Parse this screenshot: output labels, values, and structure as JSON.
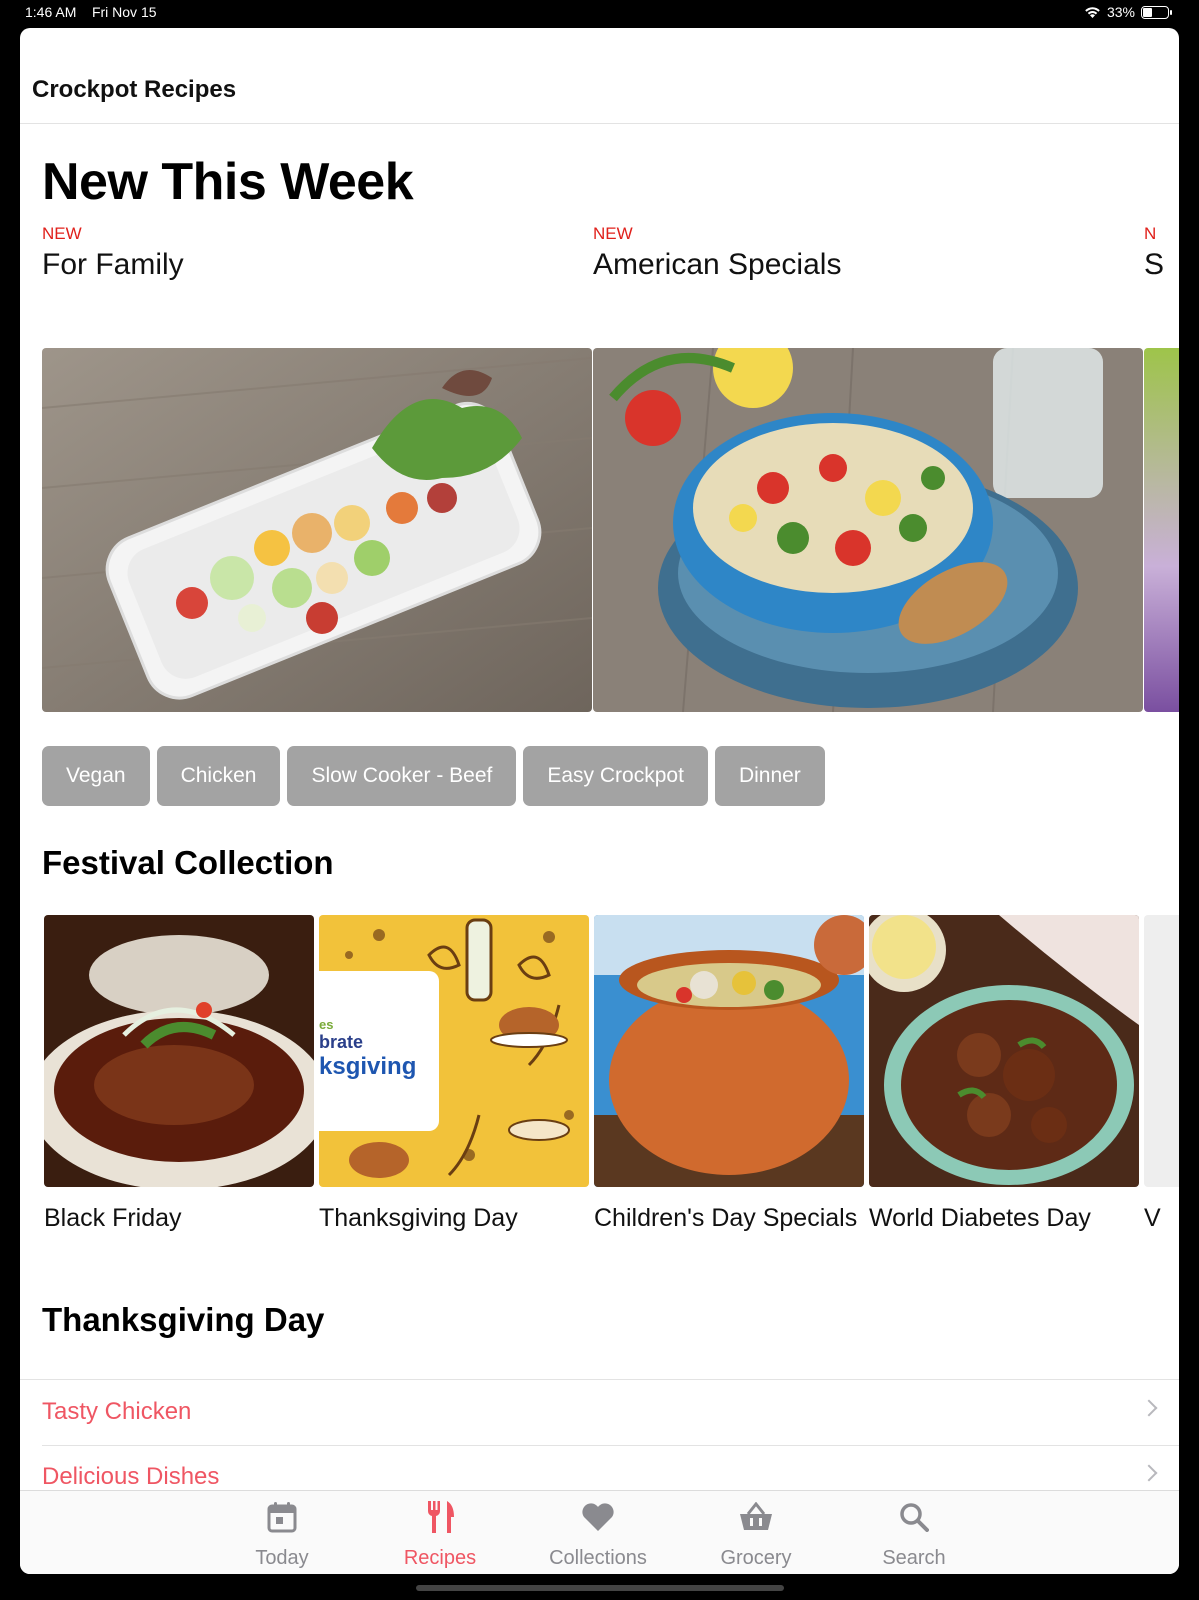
{
  "status": {
    "time": "1:46 AM",
    "date": "Fri Nov 15",
    "battery": "33%"
  },
  "nav": {
    "title": "Crockpot Recipes"
  },
  "new_this_week": {
    "heading": "New This Week",
    "items": [
      {
        "badge": "NEW",
        "title": "For Family",
        "image": "salad-platter-photo"
      },
      {
        "badge": "NEW",
        "title": "American Specials",
        "image": "quinoa-bowl-photo"
      },
      {
        "badge": "N",
        "title": "S",
        "image": "partial-photo"
      }
    ]
  },
  "tags": [
    "Vegan",
    "Chicken",
    "Slow Cooker - Beef",
    "Easy Crockpot",
    "Dinner"
  ],
  "festival": {
    "heading": "Festival Collection",
    "items": [
      {
        "label": "Black Friday",
        "image": "glazed-meat-dish-photo"
      },
      {
        "label": "Thanksgiving Day",
        "image": "thanksgiving-illustration",
        "card_text": [
          "es",
          "brate",
          "ksgiving"
        ]
      },
      {
        "label": "Children's Day Specials",
        "image": "clay-pot-stew-photo"
      },
      {
        "label": "World Diabetes Day",
        "image": "chicken-curry-photo"
      },
      {
        "label": "V",
        "image": "partial"
      }
    ]
  },
  "thanksgiving": {
    "heading": "Thanksgiving Day",
    "items": [
      "Tasty Chicken",
      "Delicious Dishes"
    ]
  },
  "tabbar": {
    "items": [
      {
        "label": "Today",
        "icon": "calendar-icon"
      },
      {
        "label": "Recipes",
        "icon": "fork-knife-icon",
        "active": true
      },
      {
        "label": "Collections",
        "icon": "heart-icon"
      },
      {
        "label": "Grocery",
        "icon": "basket-icon"
      },
      {
        "label": "Search",
        "icon": "search-icon"
      }
    ]
  },
  "colors": {
    "accent": "#ef5663",
    "badge_red": "#e0201b",
    "tag_gray": "#a3a3a3"
  }
}
